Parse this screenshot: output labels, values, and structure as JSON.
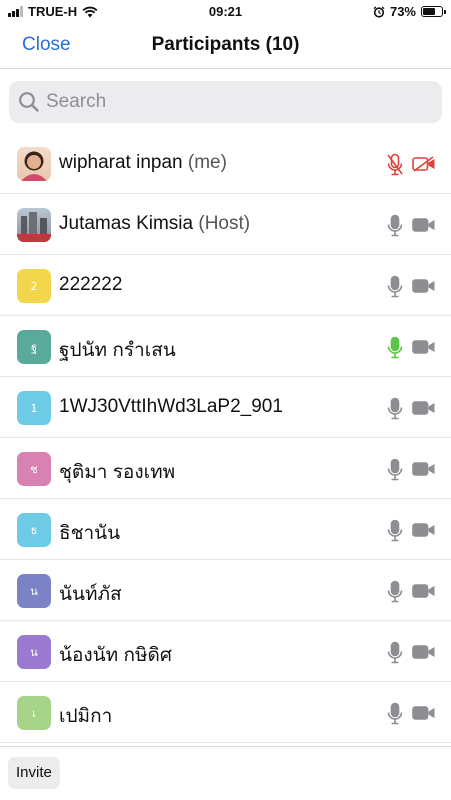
{
  "status_bar": {
    "carrier": "TRUE-H",
    "time": "09:21",
    "battery": "73%",
    "battery_level": 0.73
  },
  "header": {
    "close_label": "Close",
    "title": "Participants (10)"
  },
  "search": {
    "placeholder": "Search"
  },
  "participants": [
    {
      "name": "wipharat inpan",
      "tag": "(me)",
      "avatar": "photo",
      "avatar_color": "#e9c7b0",
      "mic": "muted",
      "video": "off"
    },
    {
      "name": "Jutamas Kimsia",
      "tag": "(Host)",
      "avatar": "photo",
      "avatar_color": "#8f8f96",
      "mic": "idle",
      "video": "on"
    },
    {
      "name": "222222",
      "tag": "",
      "avatar": "2",
      "avatar_color": "#f2d64b",
      "mic": "idle",
      "video": "on"
    },
    {
      "name": "ฐปนัท กรำเสน",
      "tag": "",
      "avatar": "ฐ",
      "avatar_color": "#5aaa9b",
      "mic": "speaking",
      "video": "on"
    },
    {
      "name": "1WJ30VttIhWd3LaP2_901",
      "tag": "",
      "avatar": "1",
      "avatar_color": "#6ecbe6",
      "mic": "idle",
      "video": "on"
    },
    {
      "name": "ชุติมา รองเทพ",
      "tag": "",
      "avatar": "ช",
      "avatar_color": "#d782b3",
      "mic": "idle",
      "video": "on"
    },
    {
      "name": "ธิชานัน",
      "tag": "",
      "avatar": "ธ",
      "avatar_color": "#6ecbe6",
      "mic": "idle",
      "video": "on"
    },
    {
      "name": "นันท์ภัส",
      "tag": "",
      "avatar": "น",
      "avatar_color": "#7b83c6",
      "mic": "idle",
      "video": "on"
    },
    {
      "name": "น้องนัท กษิดิศ",
      "tag": "",
      "avatar": "น",
      "avatar_color": "#9b7ad1",
      "mic": "idle",
      "video": "on"
    },
    {
      "name": "เปมิกา",
      "tag": "",
      "avatar": "เ",
      "avatar_color": "#a6d58a",
      "mic": "idle",
      "video": "on"
    }
  ],
  "footer": {
    "invite_label": "Invite"
  },
  "colors": {
    "accent": "#2a6fd6",
    "muted_red": "#e0413a",
    "speaking_green": "#5cc447",
    "icon_gray": "#8d8d92"
  },
  "icons": {
    "search": "search-icon",
    "mic": "microphone-icon",
    "video": "video-camera-icon",
    "wifi": "wifi-icon",
    "alarm": "alarm-icon",
    "battery": "battery-icon"
  }
}
